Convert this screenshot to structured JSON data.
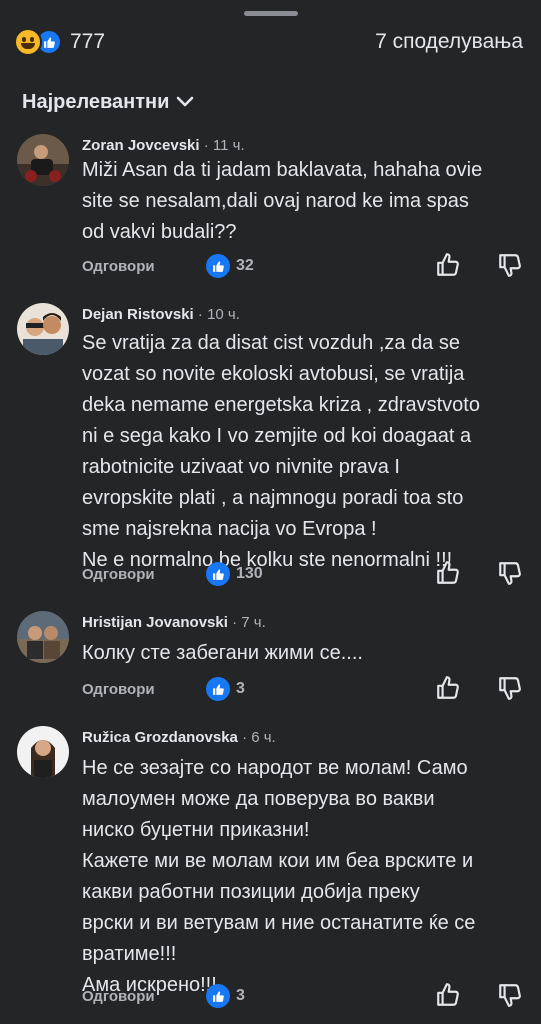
{
  "summary": {
    "reaction_icons": [
      "haha-emoji-icon",
      "like-icon"
    ],
    "reaction_count": "777",
    "shares": "7 споделувања"
  },
  "sort": {
    "label": "Најрелевантни"
  },
  "comments": [
    {
      "author": "Zoran Jovcevski",
      "time": "11 ч.",
      "text_lines": [
        "Miži Asan da ti jadam baklavata, hahaha ovie",
        "site se nesalam,dali ovaj narod ke ima spas",
        "od vakvi budali??"
      ],
      "reply": "Одговори",
      "likes": "32"
    },
    {
      "author": "Dejan Ristovski",
      "time": "10 ч.",
      "text_lines": [
        "Se vratija za da disat cist vozduh ,za da se",
        "vozat so novite ekoloski avtobusi,  se vratija",
        "deka nemame energetska kriza , zdravstvoto",
        "ni e sega kako I vo zemjite od koi doagaat a",
        "rabotnicite uzivaat vo nivnite prava I",
        "evropskite plati , a najmnogu poradi toa sto",
        "sme najsrekna nacija vo Evropa !",
        "Ne e normalno be kolku ste nenormalni !!!"
      ],
      "reply": "Одговори",
      "likes": "130"
    },
    {
      "author": "Hristijan Jovanovski",
      "time": "7 ч.",
      "text_lines": [
        "Колку сте забегани жими се...."
      ],
      "reply": "Одговори",
      "likes": "3"
    },
    {
      "author": "Ružica Grozdanovska",
      "time": "6 ч.",
      "text_lines": [
        "Не се зезајте со народот ве молам! Само",
        "малоумен може да поверува во вакви",
        "ниско буџетни приказни!",
        "Кажете ми ве молам кои им беа врските и",
        "какви работни позиции добија преку",
        "врски и ви ветувам и ние останатите ќе се",
        "вратиме!!!",
        "Ама искрено!!!"
      ],
      "reply": "Одговори",
      "likes": "3"
    }
  ],
  "colors": {
    "background": "#242526",
    "text": "#e4e6eb",
    "secondary_text": "#b0b3b8",
    "like_blue": "#1877f2",
    "haha_yellow": "#f7b928"
  }
}
